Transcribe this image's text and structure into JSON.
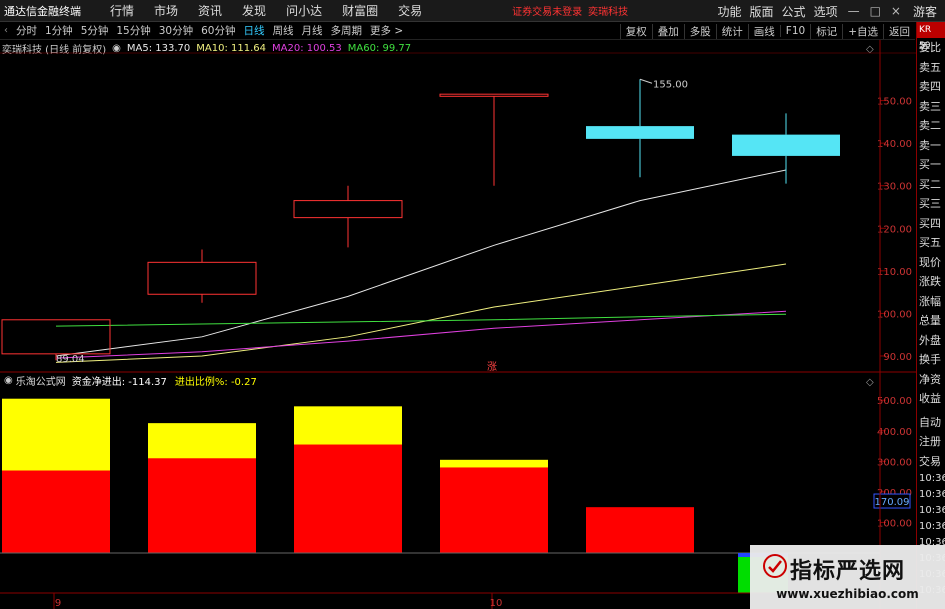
{
  "app": {
    "title": "通达信金融终端",
    "menu": [
      "行情",
      "市场",
      "资讯",
      "发现",
      "问小达",
      "财富圈",
      "交易"
    ],
    "status_notice": "证券交易未登录",
    "stock_name_tab": "奕瑞科技",
    "right_menu": [
      "功能",
      "版面",
      "公式",
      "选项"
    ],
    "window_controls": [
      "—",
      "□",
      "×"
    ],
    "guest": "游客"
  },
  "toolbar": {
    "periods": [
      "分时",
      "1分钟",
      "5分钟",
      "15分钟",
      "30分钟",
      "60分钟",
      "日线",
      "周线",
      "月线",
      "多周期",
      "更多 >"
    ],
    "active_period": "日线",
    "tools": [
      "复权",
      "叠加",
      "多股",
      "统计",
      "画线",
      "F10",
      "标记",
      "+自选",
      "返回"
    ]
  },
  "main_chart_info": {
    "stock": "奕瑞科技 (日线 前复权)",
    "ma": [
      {
        "label": "MA5: 133.70",
        "color": "#e8e8e8"
      },
      {
        "label": "MA10: 111.64",
        "color": "#f0f080"
      },
      {
        "label": "MA20: 100.53",
        "color": "#e040e0"
      },
      {
        "label": "MA60: 99.77",
        "color": "#40e040"
      }
    ],
    "high_label": "155.00",
    "low_label": "89.04",
    "limit_up_mark": "涨"
  },
  "sub_chart_info": {
    "indicator": "乐淘公式网",
    "net_flow": "资金净进出: -114.37",
    "ratio": "进出比例%: -0.27",
    "current_value": "170.09"
  },
  "x_axis": {
    "labels": [
      "9",
      "10"
    ]
  },
  "chart_data": [
    {
      "type": "candlestick",
      "title": "奕瑞科技 (日线 前复权)",
      "ylim": [
        86,
        160
      ],
      "y_ticks": [
        "150.00",
        "140.00",
        "130.00",
        "120.00",
        "110.00",
        "100.00",
        "90.00"
      ],
      "candles": [
        {
          "open": 98.5,
          "close": 90.5,
          "high": 98.5,
          "low": 89.0,
          "color": "red"
        },
        {
          "open": 104.5,
          "close": 112.0,
          "high": 115.0,
          "low": 102.5,
          "color": "red"
        },
        {
          "open": 122.5,
          "close": 126.5,
          "high": 130.0,
          "low": 115.5,
          "color": "red"
        },
        {
          "open": 151.0,
          "close": 151.5,
          "high": 151.5,
          "low": 130.0,
          "color": "red"
        },
        {
          "open": 144.0,
          "close": 141.0,
          "high": 155.0,
          "low": 132.0,
          "color": "cyan"
        },
        {
          "open": 142.0,
          "close": 137.0,
          "high": 147.0,
          "low": 130.5,
          "color": "cyan"
        }
      ],
      "series": [
        {
          "name": "MA5",
          "color": "#e8e8e8",
          "values": [
            90.0,
            94.5,
            104.0,
            116.0,
            126.5,
            133.7
          ]
        },
        {
          "name": "MA10",
          "color": "#f0f080",
          "values": [
            88.5,
            90.0,
            94.5,
            101.5,
            106.5,
            111.6
          ]
        },
        {
          "name": "MA20",
          "color": "#e040e0",
          "values": [
            89.5,
            91.0,
            93.5,
            96.5,
            98.5,
            100.5
          ]
        },
        {
          "name": "MA60",
          "color": "#40e040",
          "values": [
            97.0,
            97.5,
            98.0,
            98.5,
            99.2,
            99.8
          ]
        }
      ]
    },
    {
      "type": "bar",
      "title": "乐淘公式网",
      "ylim": [
        0,
        540
      ],
      "y_ticks": [
        "500.00",
        "400.00",
        "300.00",
        "200.00",
        "100.00"
      ],
      "series": [
        {
          "name": "red",
          "color": "#ff0000",
          "values": [
            270,
            310,
            355,
            280,
            150,
            0
          ]
        },
        {
          "name": "yellow",
          "color": "#ffff00",
          "values": [
            505,
            425,
            480,
            305,
            0,
            0
          ]
        }
      ],
      "negative_value": -110
    }
  ],
  "right_panel": {
    "top_label": "KR 50",
    "items": [
      "委比",
      "卖五",
      "卖四",
      "卖三",
      "卖二",
      "卖一",
      "买一",
      "买二",
      "买三",
      "买四",
      "买五",
      "现价",
      "涨跌",
      "涨幅",
      "总量",
      "外盘",
      "换手",
      "净资",
      "收益"
    ],
    "sub_items": [
      "自动",
      "注册",
      "交易"
    ],
    "times": [
      "10:36",
      "10:36",
      "10:36",
      "10:36",
      "10:36",
      "10:36",
      "10:36",
      "10:36"
    ]
  },
  "watermark": {
    "title": "指标严选网",
    "url": "www.xuezhibiao.com"
  }
}
